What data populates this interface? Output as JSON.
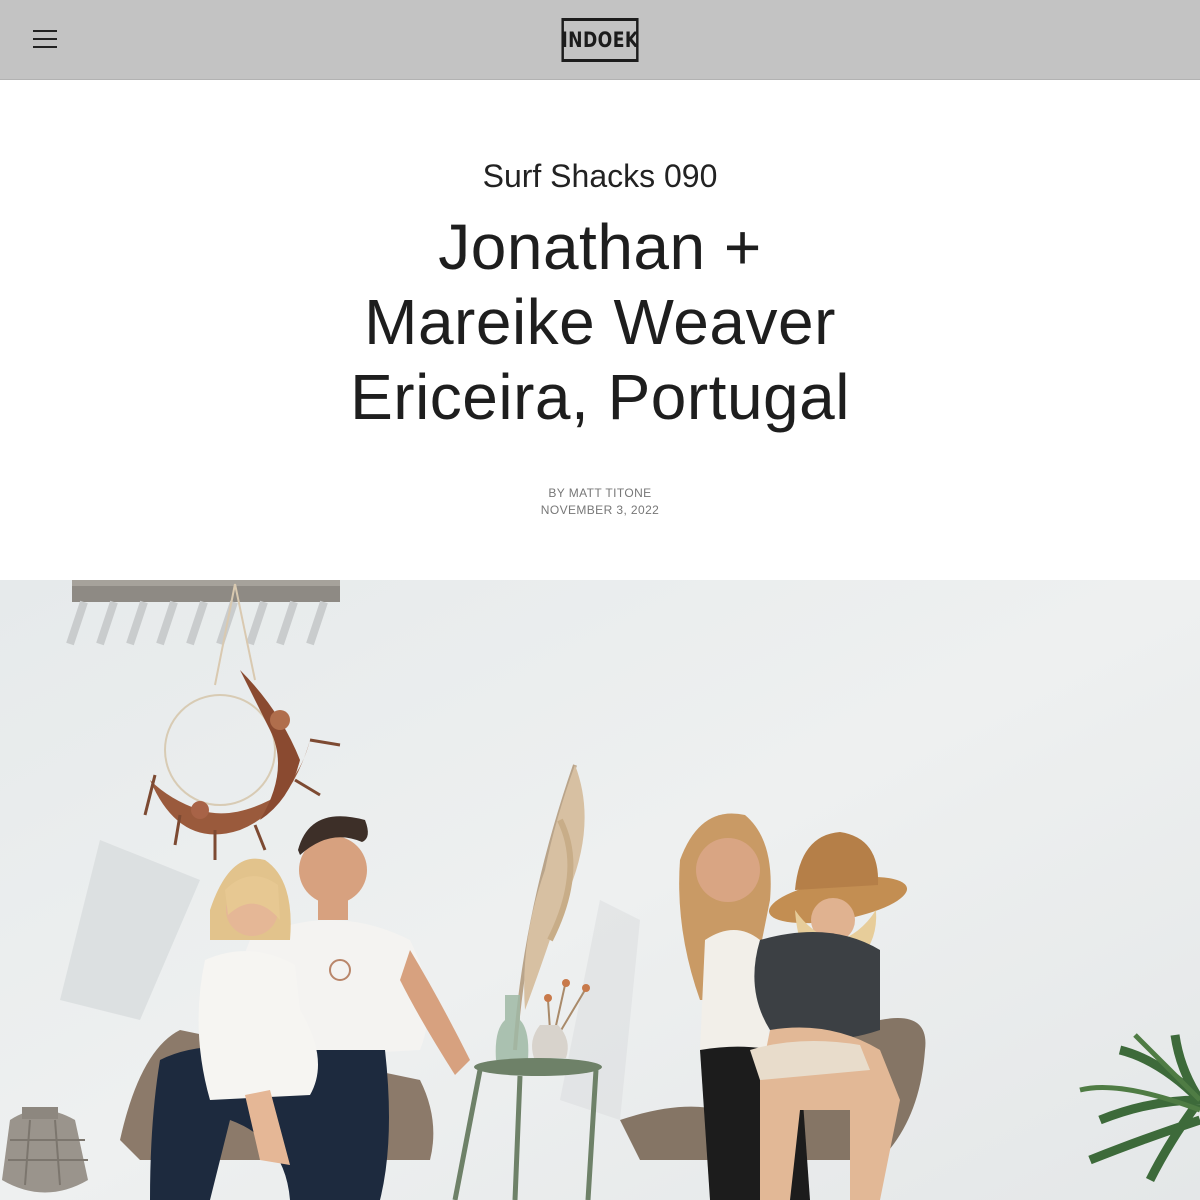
{
  "nav": {
    "menu_icon": "hamburger-menu-icon",
    "logo_text": "INDOEK"
  },
  "article": {
    "kicker": "Surf Shacks 090",
    "title_lines": [
      "Jonathan +",
      "Mareike Weaver",
      "Ericeira, Portugal"
    ],
    "byline": "BY MATT TITONE",
    "date": "NOVEMBER 3, 2022"
  },
  "hero_image": {
    "subject": "family-portrait-photo"
  },
  "colors": {
    "topbar": "#c3c3c3",
    "text": "#1f1f1f",
    "meta_text": "#777777",
    "wall": "#e9ecec"
  }
}
